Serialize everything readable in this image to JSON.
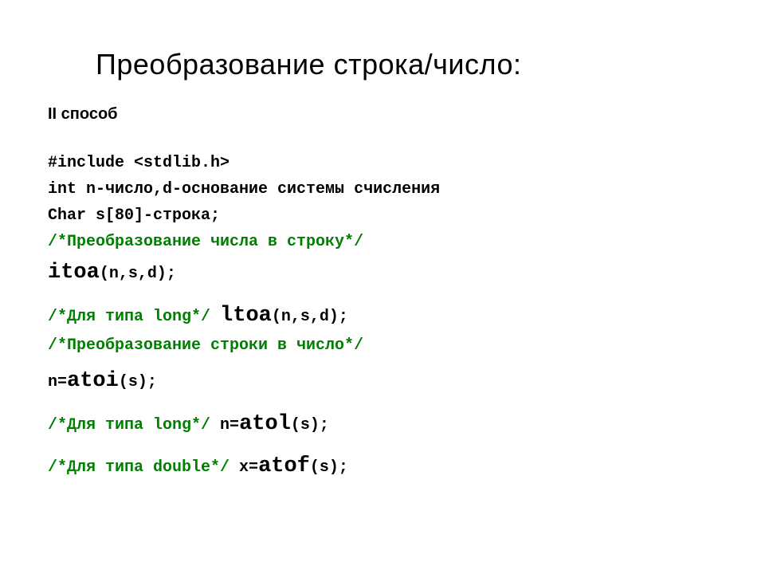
{
  "title": "Преобразование строка/число:",
  "subtitle": "II способ",
  "lines": {
    "include": "#include <stdlib.h>",
    "vars1": "int n-число,d-основание системы счисления",
    "vars2": "Char s[80]-строка;",
    "comment1": "/*Преобразование числа в строку*/",
    "itoa_fn": "itoa",
    "itoa_args": "(n,s,d);",
    "comment_long1": "/*Для типа long*/ ",
    "ltoa_fn": "ltoa",
    "ltoa_args": "(n,s,d);",
    "comment2": "/*Преобразование строки в число*/",
    "atoi_prefix": "n=",
    "atoi_fn": "atoi",
    "atoi_args": "(s);",
    "comment_long2": "/*Для типа long*/ ",
    "atol_prefix": "n=",
    "atol_fn": "atol",
    "atol_args": "(s);",
    "comment_double": "/*Для типа double*/ ",
    "atof_prefix": "x=",
    "atof_fn": "atof",
    "atof_args": "(s);"
  }
}
